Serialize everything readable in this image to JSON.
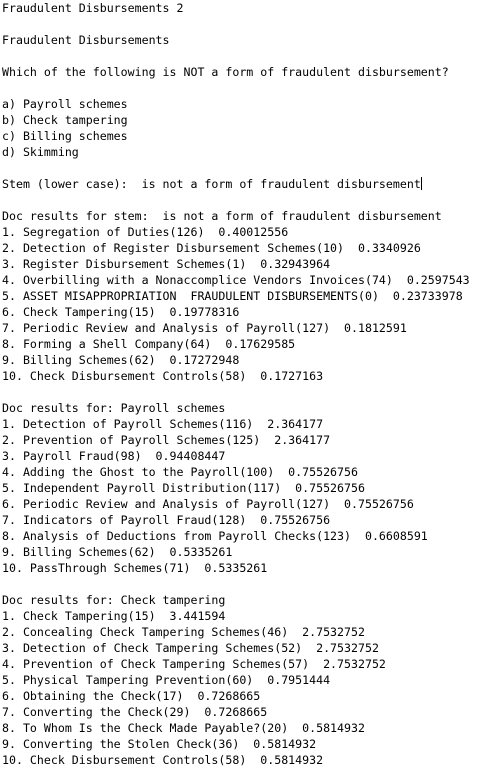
{
  "header": {
    "window_title": "Fraudulent Disbursements 2",
    "section_title": "Fraudulent Disbursements"
  },
  "question": {
    "text": "Which of the following is NOT a form of fraudulent disbursement?",
    "options": [
      "a) Payroll schemes",
      "b) Check tampering",
      "c) Billing schemes",
      "d) Skimming"
    ]
  },
  "stem": {
    "label": "Stem (lower case):",
    "value": "is not a form of fraudulent disbursement"
  },
  "results": [
    {
      "header": "Doc results for stem:  is not a form of fraudulent disbursement",
      "items": [
        "1. Segregation of Duties(126)  0.40012556",
        "2. Detection of Register Disbursement Schemes(10)  0.3340926",
        "3. Register Disbursement Schemes(1)  0.32943964",
        "4. Overbilling with a Nonaccomplice Vendors Invoices(74)  0.2597543",
        "5. ASSET MISAPPROPRIATION  FRAUDULENT DISBURSEMENTS(0)  0.23733978",
        "6. Check Tampering(15)  0.19778316",
        "7. Periodic Review and Analysis of Payroll(127)  0.1812591",
        "8. Forming a Shell Company(64)  0.17629585",
        "9. Billing Schemes(62)  0.17272948",
        "10. Check Disbursement Controls(58)  0.1727163"
      ]
    },
    {
      "header": "Doc results for: Payroll schemes",
      "items": [
        "1. Detection of Payroll Schemes(116)  2.364177",
        "2. Prevention of Payroll Schemes(125)  2.364177",
        "3. Payroll Fraud(98)  0.94408447",
        "4. Adding the Ghost to the Payroll(100)  0.75526756",
        "5. Independent Payroll Distribution(117)  0.75526756",
        "6. Periodic Review and Analysis of Payroll(127)  0.75526756",
        "7. Indicators of Payroll Fraud(128)  0.75526756",
        "8. Analysis of Deductions from Payroll Checks(123)  0.6608591",
        "9. Billing Schemes(62)  0.5335261",
        "10. PassThrough Schemes(71)  0.5335261"
      ]
    },
    {
      "header": "Doc results for: Check tampering",
      "items": [
        "1. Check Tampering(15)  3.441594",
        "2. Concealing Check Tampering Schemes(46)  2.7532752",
        "3. Detection of Check Tampering Schemes(52)  2.7532752",
        "4. Prevention of Check Tampering Schemes(57)  2.7532752",
        "5. Physical Tampering Prevention(60)  0.7951444",
        "6. Obtaining the Check(17)  0.7268665",
        "7. Converting the Check(29)  0.7268665",
        "8. To Whom Is the Check Made Payable?(20)  0.5814932",
        "9. Converting the Stolen Check(36)  0.5814932",
        "10. Check Disbursement Controls(58)  0.5814932"
      ]
    }
  ]
}
